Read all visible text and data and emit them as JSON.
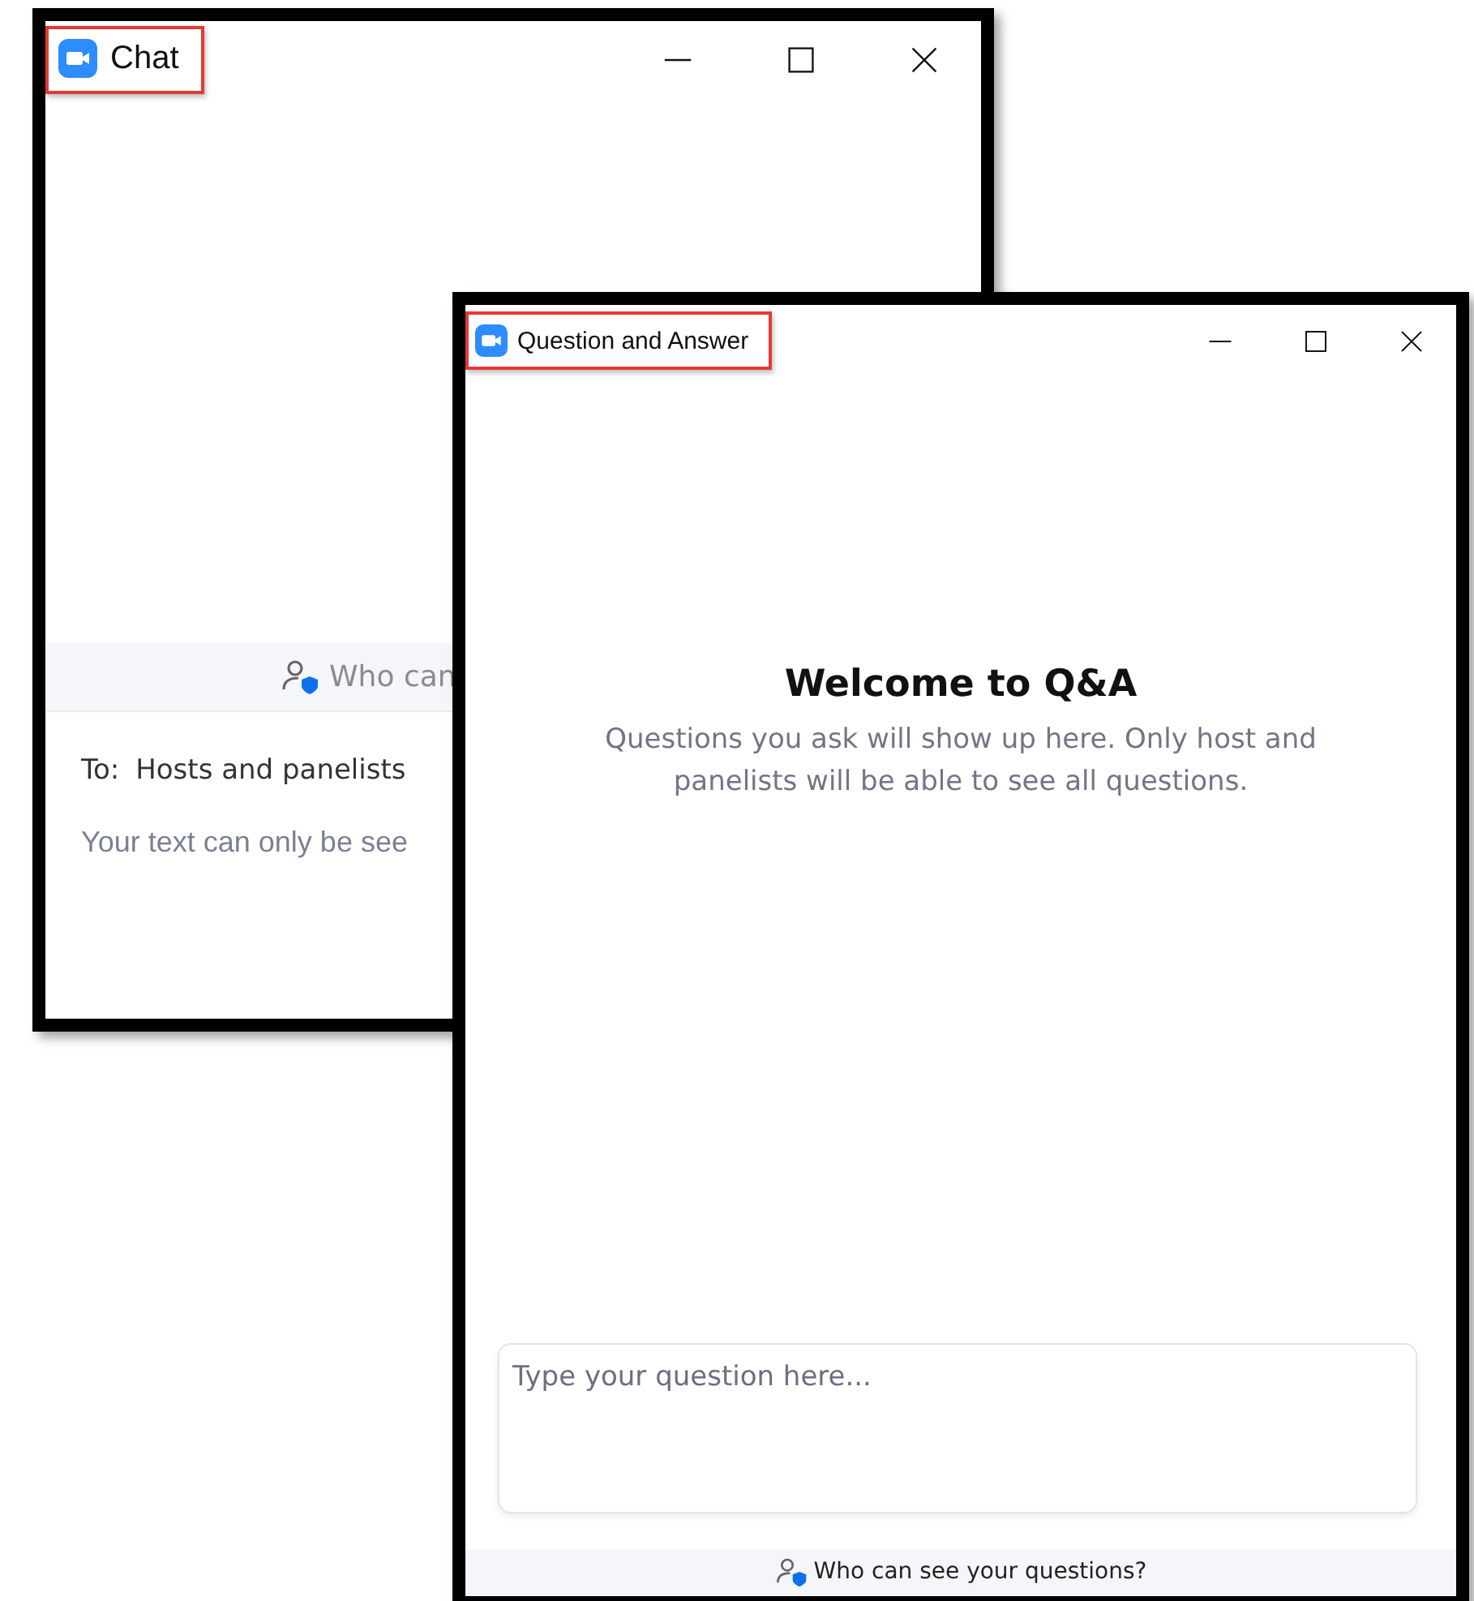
{
  "chat_window": {
    "title": "Chat",
    "privacy_notice": "Who can",
    "recipient_label": "To:",
    "recipient": "Hosts and panelists",
    "input": {
      "placeholder": "Your text can only be see"
    }
  },
  "qa_window": {
    "title": "Question and Answer",
    "heading": "Welcome to Q&A",
    "description": "Questions you ask will show up here. Only host and panelists will be able to see all questions.",
    "input": {
      "placeholder": "Type your question here..."
    },
    "privacy_notice": "Who can see your questions?"
  }
}
